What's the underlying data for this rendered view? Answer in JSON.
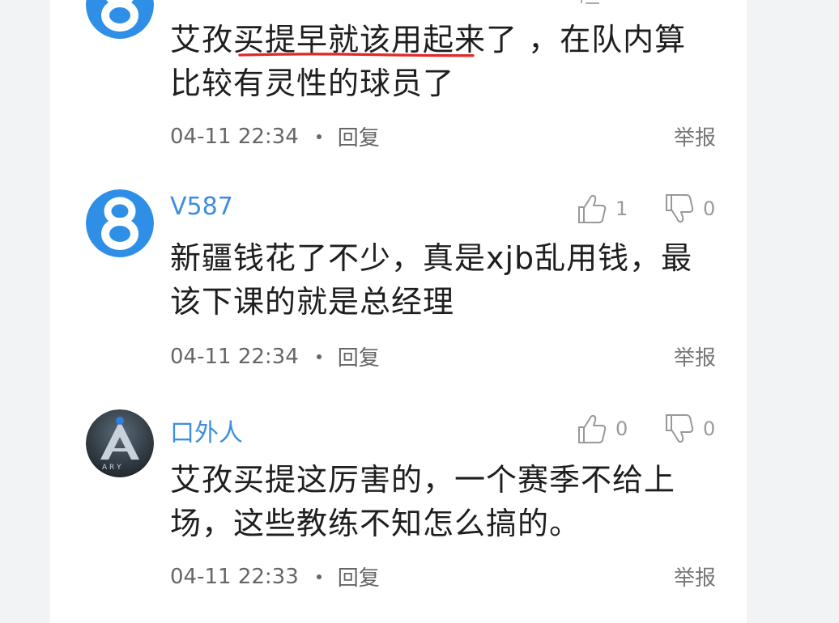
{
  "comments": [
    {
      "username": "",
      "avatar": "8-logo-icon",
      "text_underlined": "艾孜买提早就该用起来了",
      "text_rest_line1": "，在队内算",
      "text_line2": "比较有灵性的球员了",
      "time": "04-11 22:34",
      "reply_label": "回复",
      "report_label": "举报"
    },
    {
      "username": "V587",
      "avatar": "8-logo-icon",
      "likes": "1",
      "dislikes": "0",
      "text_line1": "新疆钱花了不少，真是xjb乱用钱，最",
      "text_line2": "该下课的就是总经理",
      "time": "04-11 22:34",
      "reply_label": "回复",
      "report_label": "举报"
    },
    {
      "username": "口外人",
      "avatar": "ark-logo-icon",
      "likes": "0",
      "dislikes": "0",
      "text_line1": "艾孜买提这厉害的，一个赛季不给上",
      "text_line2": "场，这些教练不知怎么搞的。",
      "time": "04-11 22:33",
      "reply_label": "回复",
      "report_label": "举报"
    }
  ],
  "colors": {
    "username": "#3d8ee0",
    "highlight_underline": "#e02a2a",
    "avatar_blue": "#2f8fe6"
  }
}
